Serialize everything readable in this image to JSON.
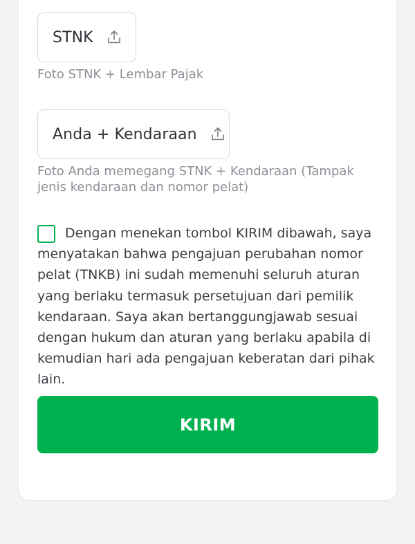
{
  "uploads": [
    {
      "label": "STNK",
      "icon": "upload-icon",
      "helper": "Foto STNK + Lembar Pajak"
    },
    {
      "label": "Anda + Kendaraan",
      "icon": "upload-icon",
      "helper": "Foto Anda memegang STNK + Kendaraan (Tampak jenis kendaraan dan nomor pelat)"
    }
  ],
  "consent": {
    "checked": false,
    "text": "Dengan menekan tombol KIRIM dibawah, saya menyatakan bahwa pengajuan perubahan nomor pelat (TNKB) ini sudah memenuhi seluruh aturan yang berlaku termasuk persetujuan dari pemilik kendaraan. Saya akan bertanggungjawab sesuai dengan hukum dan aturan yang berlaku apabila di kemudian hari ada pengajuan keberatan dari pihak lain."
  },
  "submit": {
    "label": "KIRIM"
  },
  "colors": {
    "accent": "#00b14f",
    "helper_text": "#8b9096",
    "border": "#d7dadd"
  }
}
